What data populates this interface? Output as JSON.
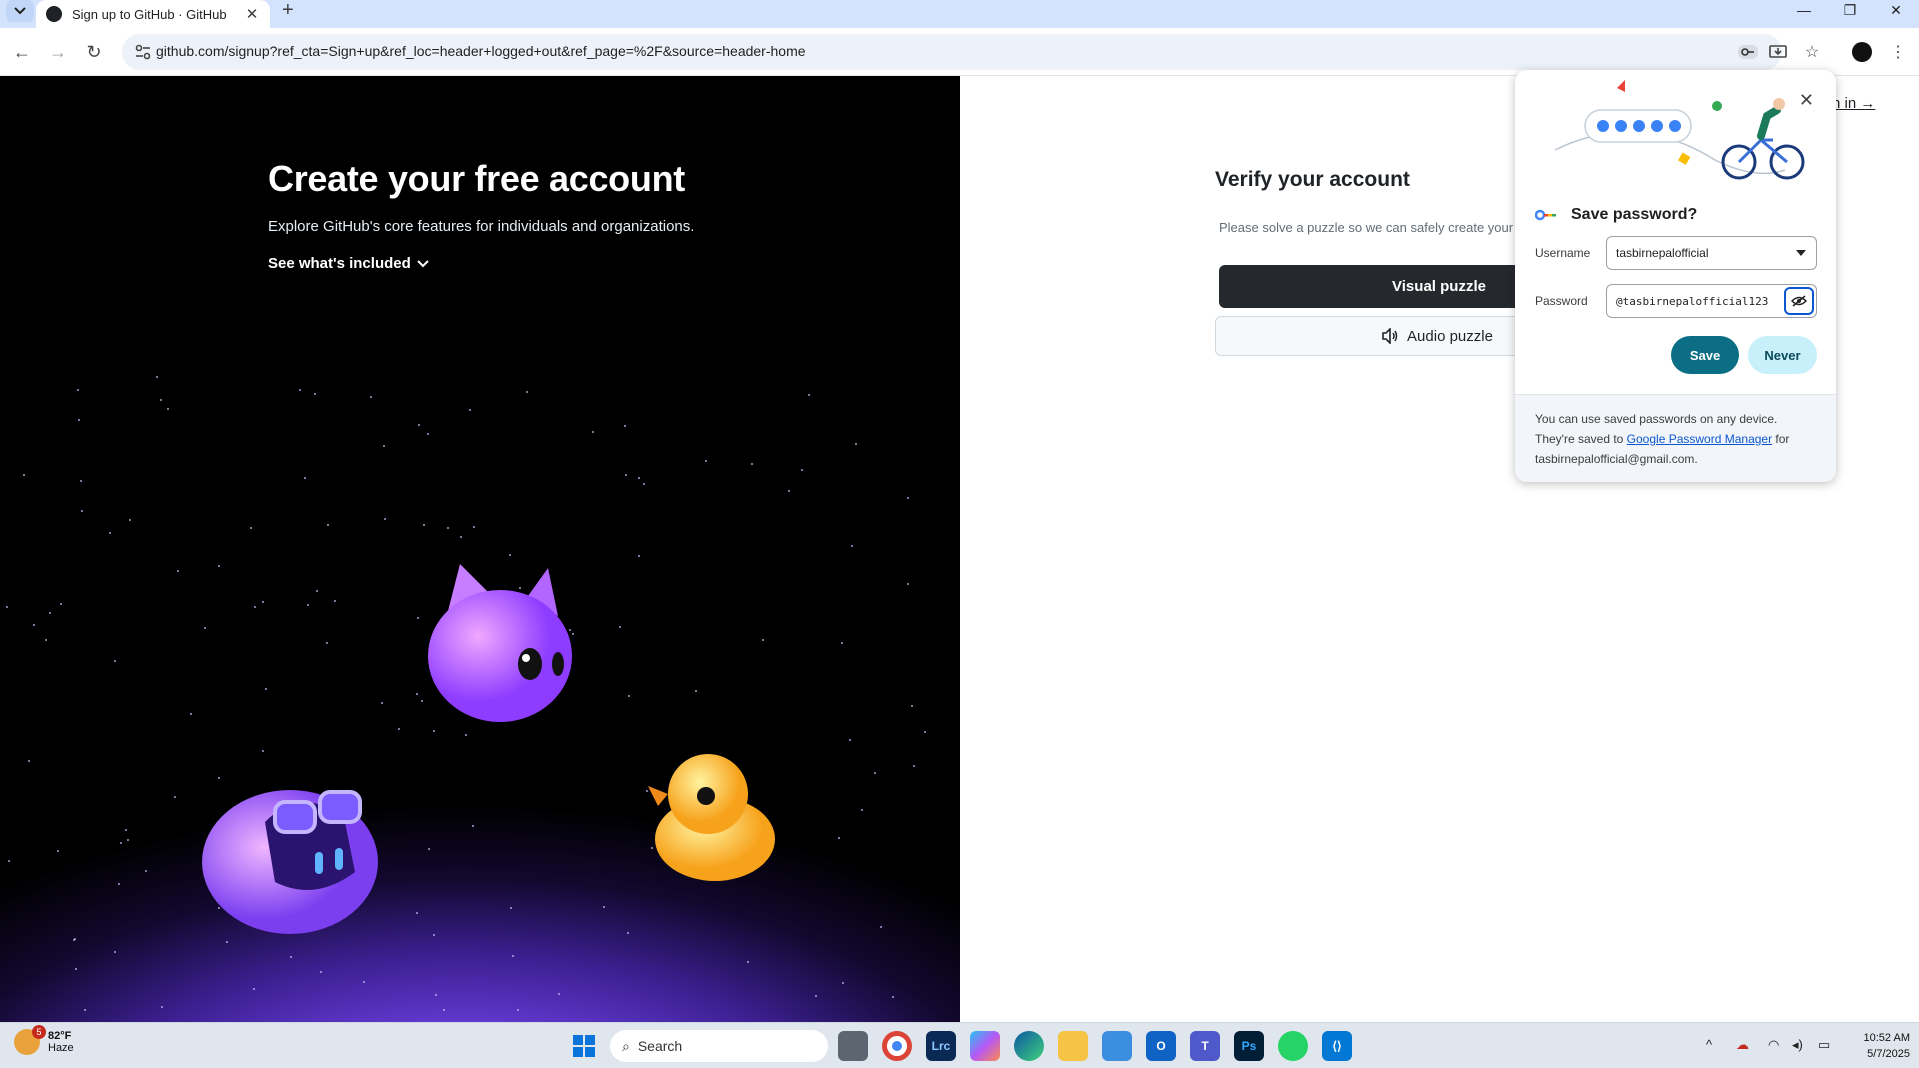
{
  "browser": {
    "tab_title": "Sign up to GitHub · GitHub",
    "new_tab": "+",
    "url": "github.com/signup?ref_cta=Sign+up&ref_loc=header+logged+out&ref_page=%2F&source=header-home",
    "icons": [
      "tab-search-icon",
      "back-icon",
      "forward-icon",
      "reload-icon",
      "site-info-icon",
      "key-icon",
      "install-icon",
      "star-icon",
      "profile-icon",
      "menu-icon"
    ]
  },
  "hero": {
    "title": "Create your free account",
    "subtitle": "Explore GitHub's core features for individuals and organizations.",
    "link": "See what's included"
  },
  "verify": {
    "title": "Verify your account",
    "description": "Please solve a puzzle so we can safely create your",
    "visual_button": "Visual puzzle",
    "audio_button": "Audio puzzle",
    "signin": "n in →"
  },
  "password_popup": {
    "title": "Save password?",
    "username_label": "Username",
    "username_value": "tasbirnepalofficial",
    "password_label": "Password",
    "password_value": "@tasbirnepalofficial123",
    "save_label": "Save",
    "never_label": "Never",
    "footer_pre": "You can use saved passwords on any device. They're saved to ",
    "footer_link": "Google Password Manager",
    "footer_post": " for tasbirnepalofficial@gmail.com."
  },
  "taskbar": {
    "weather_temp": "82°F",
    "weather_desc": "Haze",
    "weather_badge": "5",
    "search_placeholder": "Search",
    "time": "10:52 AM",
    "date": "5/7/2025",
    "apps": [
      "start",
      "file-view",
      "chrome",
      "lrc",
      "copilot",
      "edge",
      "files",
      "store",
      "outlook",
      "teams",
      "ps",
      "whatsapp",
      "vscode"
    ]
  },
  "colors": {
    "accent_teal": "#0b6e84",
    "github_dark": "#25292e",
    "chrome_blue": "#0b57d0"
  }
}
